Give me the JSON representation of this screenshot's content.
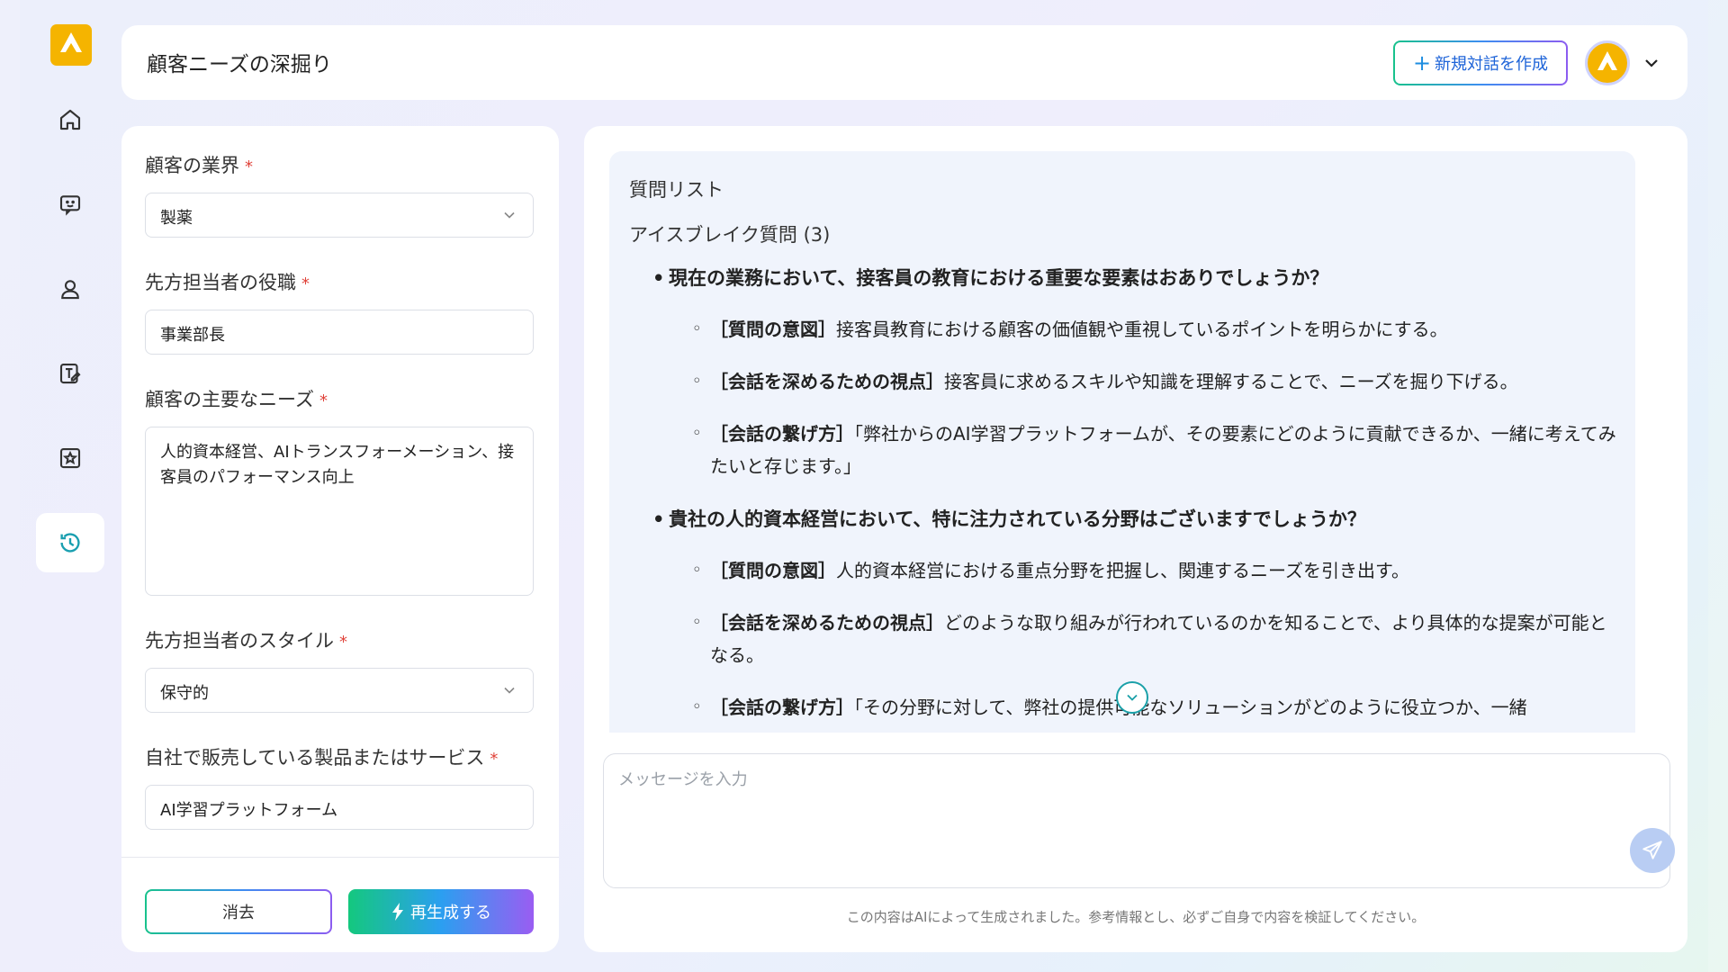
{
  "header": {
    "title": "顧客ニーズの深掘り",
    "new_chat_label": "新規対話を作成",
    "new_chat_icon": "+"
  },
  "sidebar": {
    "items": [
      {
        "name": "home",
        "active": false
      },
      {
        "name": "chat",
        "active": false
      },
      {
        "name": "user",
        "active": false
      },
      {
        "name": "edit-doc",
        "active": false
      },
      {
        "name": "star-box",
        "active": false
      },
      {
        "name": "history",
        "active": true
      }
    ]
  },
  "form": {
    "industry": {
      "label": "顧客の業界",
      "required": "*",
      "value": "製薬"
    },
    "role": {
      "label": "先方担当者の役職",
      "required": "*",
      "value": "事業部長"
    },
    "needs": {
      "label": "顧客の主要なニーズ",
      "required": "*",
      "value": "人的資本経営、AIトランスフォーメーション、接客員のパフォーマンス向上"
    },
    "style": {
      "label": "先方担当者のスタイル",
      "required": "*",
      "value": "保守的"
    },
    "product": {
      "label": "自社で販売している製品またはサービス",
      "required": "*",
      "value": "AI学習プラットフォーム"
    },
    "clear_label": "消去",
    "regen_label": "再生成する"
  },
  "answer": {
    "heading": "質問リスト",
    "section": "アイスブレイク質問 (3)",
    "questions": [
      {
        "text": "現在の業務において、接客員の教育における重要な要素はおありでしょうか？",
        "subs": [
          {
            "tag": "［質問の意図］",
            "text": "接客員教育における顧客の価値観や重視しているポイントを明らかにする。"
          },
          {
            "tag": "［会話を深めるための視点］",
            "text": "接客員に求めるスキルや知識を理解することで、ニーズを掘り下げる。"
          },
          {
            "tag": "［会話の繋げ方］",
            "text": "「弊社からのAI学習プラットフォームが、その要素にどのように貢献できるか、一緒に考えてみたいと存じます。」"
          }
        ]
      },
      {
        "text": "貴社の人的資本経営において、特に注力されている分野はございますでしょうか？",
        "subs": [
          {
            "tag": "［質問の意図］",
            "text": "人的資本経営における重点分野を把握し、関連するニーズを引き出す。"
          },
          {
            "tag": "［会話を深めるための視点］",
            "text": "どのような取り組みが行われているのかを知ることで、より具体的な提案が可能となる。"
          },
          {
            "tag": "［会話の繋げ方］",
            "text": "「その分野に対して、弊社の提供可能なソリューションがどのように役立つか、一緒"
          }
        ]
      }
    ]
  },
  "chat": {
    "placeholder": "メッセージを入力",
    "disclaimer": "この内容はAIによって生成されました。参考情報とし、必ずご自身で内容を検証してください。"
  },
  "colors": {
    "accent_blue": "#1d63d8",
    "required_red": "#e0433a",
    "brand_yellow": "#f5b400"
  }
}
